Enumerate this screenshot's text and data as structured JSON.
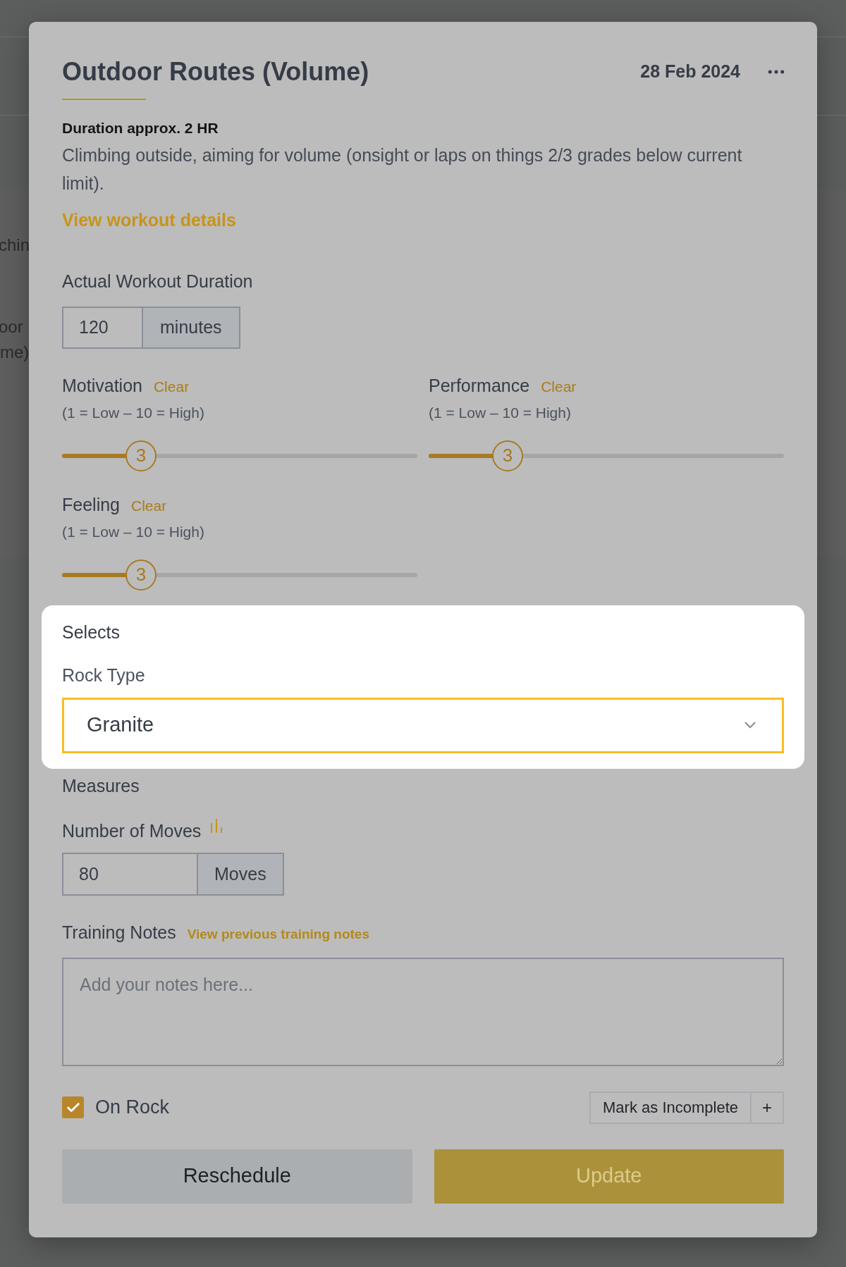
{
  "background": {
    "fragments": [
      "chin",
      "oor",
      "me)"
    ]
  },
  "header": {
    "title": "Outdoor Routes (Volume)",
    "date": "28 Feb 2024"
  },
  "summary": {
    "duration": "Duration approx. 2 HR",
    "description": "Climbing outside, aiming for volume (onsight or laps on things 2/3 grades below current limit).",
    "link": "View workout details"
  },
  "duration": {
    "label": "Actual Workout Duration",
    "value": "120",
    "unit": "minutes"
  },
  "ratings": [
    {
      "label": "Motivation",
      "clear": "Clear",
      "scale": "(1 = Low – 10 = High)",
      "value": "3",
      "level": 0.222
    },
    {
      "label": "Performance",
      "clear": "Clear",
      "scale": "(1 = Low – 10 = High)",
      "value": "3",
      "level": 0.222
    },
    {
      "label": "Feeling",
      "clear": "Clear",
      "scale": "(1 = Low – 10 = High)",
      "value": "3",
      "level": 0.222
    }
  ],
  "selects": {
    "heading": "Selects",
    "label": "Rock Type",
    "value": "Granite"
  },
  "measures": {
    "heading": "Measures",
    "label": "Number of Moves",
    "value": "80",
    "unit": "Moves"
  },
  "notes": {
    "label": "Training Notes",
    "link": "View previous training notes",
    "placeholder": "Add your notes here..."
  },
  "on_rock": {
    "label": "On Rock",
    "checked": true
  },
  "status_button": {
    "label": "Mark as Incomplete",
    "add": "+"
  },
  "actions": [
    {
      "label": "Reschedule",
      "kind": "secondary",
      "disabled": false
    },
    {
      "label": "Update",
      "kind": "primary",
      "disabled": true
    }
  ]
}
